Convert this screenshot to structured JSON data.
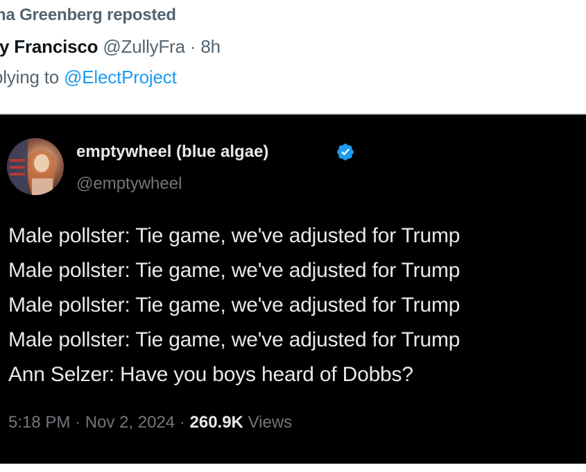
{
  "outer_tweet": {
    "repost_text": "na Greenberg reposted",
    "author_name": "ly Francisco",
    "author_handle": "@ZullyFra",
    "separator": "·",
    "time_ago": "8h",
    "replying_prefix": "plying to ",
    "replying_to": "@ElectProject"
  },
  "embedded_tweet": {
    "display_name": "emptywheel (blue algae)",
    "handle": "@emptywheel",
    "verified_color": "#1d9bf0",
    "lines": [
      "Male pollster: Tie game, we've adjusted for Trump",
      "Male pollster: Tie game, we've adjusted for Trump",
      "Male pollster: Tie game, we've adjusted for Trump",
      "Male pollster: Tie game, we've adjusted for Trump",
      "Ann Selzer: Have you boys heard of Dobbs?"
    ],
    "time": "5:18 PM",
    "separator": "·",
    "date": "Nov 2, 2024",
    "views_count": "260.9K",
    "views_label": "Views"
  }
}
